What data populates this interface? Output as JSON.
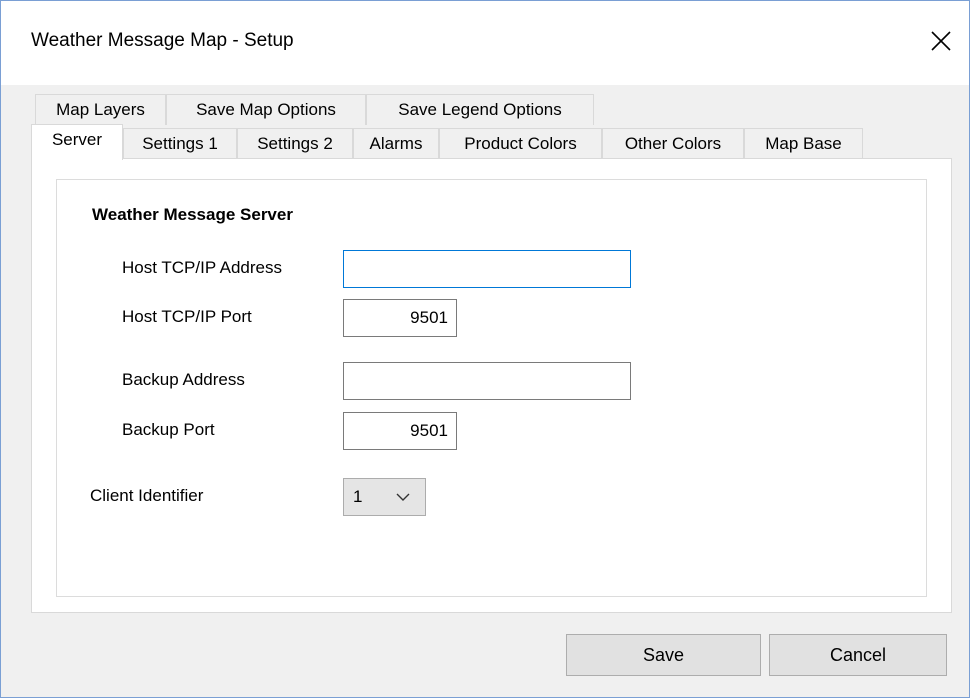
{
  "window": {
    "title": "Weather Message Map - Setup"
  },
  "tabs": {
    "row1": [
      {
        "label": "Map Layers"
      },
      {
        "label": "Save Map Options"
      },
      {
        "label": "Save Legend Options"
      }
    ],
    "row2": [
      {
        "label": "Server",
        "selected": true
      },
      {
        "label": "Settings 1"
      },
      {
        "label": "Settings 2"
      },
      {
        "label": "Alarms"
      },
      {
        "label": "Product Colors"
      },
      {
        "label": "Other Colors"
      },
      {
        "label": "Map Base"
      }
    ]
  },
  "server": {
    "group_title": "Weather Message Server",
    "host_address_label": "Host TCP/IP Address",
    "host_address_value": "",
    "host_port_label": "Host TCP/IP Port",
    "host_port_value": "9501",
    "backup_address_label": "Backup Address",
    "backup_address_value": "",
    "backup_port_label": "Backup Port",
    "backup_port_value": "9501",
    "client_id_label": "Client Identifier",
    "client_id_value": "1"
  },
  "buttons": {
    "save": "Save",
    "cancel": "Cancel"
  },
  "colors": {
    "focus_border": "#0078d7",
    "window_border": "#7a9fd4",
    "dialog_bg": "#f0f0f0"
  }
}
